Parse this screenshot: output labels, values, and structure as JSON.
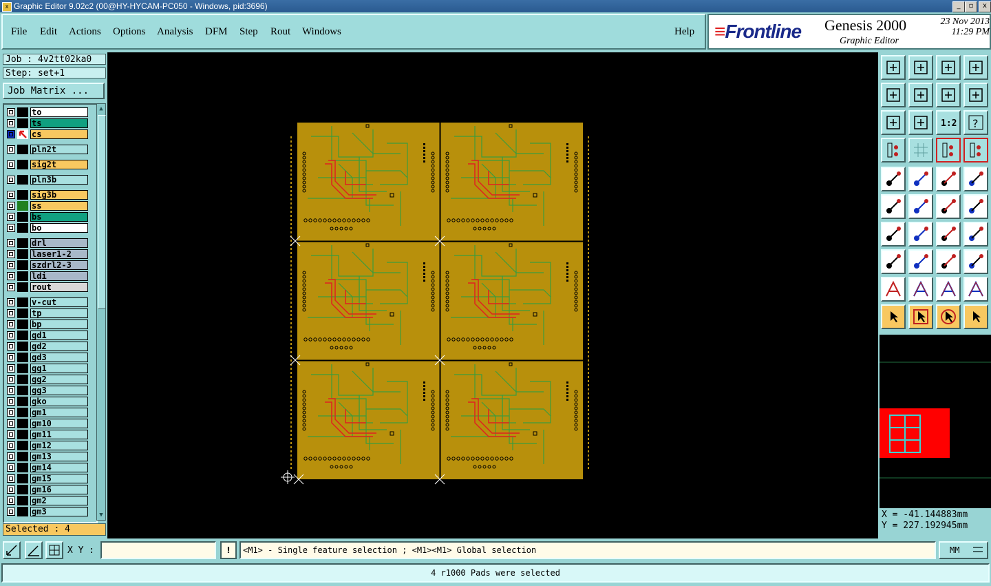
{
  "window": {
    "title": "Graphic Editor 9.02c2 (00@HY-HYCAM-PC050 - Windows, pid:3696)",
    "controls": [
      "_",
      "▫",
      "x"
    ]
  },
  "menu": {
    "items": [
      "File",
      "Edit",
      "Actions",
      "Options",
      "Analysis",
      "DFM",
      "Step",
      "Rout",
      "Windows"
    ],
    "help": "Help"
  },
  "brand": {
    "logo": "Frontline",
    "product": "Genesis 2000",
    "subtitle": "Graphic Editor",
    "date": "23 Nov 2013",
    "time": "11:29 PM"
  },
  "job": {
    "job_label": "Job : 4v2tt02ka0",
    "step_label": "Step: set+1",
    "matrix_button": "Job Matrix ..."
  },
  "layers": [
    {
      "name": "to",
      "color": "#ffffff",
      "mark": "#000000"
    },
    {
      "name": "ts",
      "color": "#10a080",
      "mark": "#000000"
    },
    {
      "name": "cs",
      "color": "#f8c860",
      "mark": "#ff3030",
      "active": true
    },
    {
      "name": "pln2t",
      "color": "#a8e0e0",
      "mark": "#000000"
    },
    {
      "name": "sig2t",
      "color": "#f8c860",
      "mark": "#000000"
    },
    {
      "name": "pln3b",
      "color": "#a8e0e0",
      "mark": "#000000"
    },
    {
      "name": "sig3b",
      "color": "#f8c860",
      "mark": "#000000"
    },
    {
      "name": "ss",
      "color": "#f8c860",
      "mark": "#208020"
    },
    {
      "name": "bs",
      "color": "#10a080",
      "mark": "#000000"
    },
    {
      "name": "bo",
      "color": "#ffffff",
      "mark": "#000000"
    },
    {
      "name": "drl",
      "color": "#a8b8c8",
      "mark": "#000000"
    },
    {
      "name": "laser1-2",
      "color": "#a8b8c8",
      "mark": "#000000"
    },
    {
      "name": "szdrl2-3",
      "color": "#a8b8c8",
      "mark": "#000000"
    },
    {
      "name": "ldi",
      "color": "#a8b8c8",
      "mark": "#000000"
    },
    {
      "name": "rout",
      "color": "#d8d8d8",
      "mark": "#000000"
    },
    {
      "name": "v-cut",
      "color": "#a8e0e0",
      "mark": "#000000"
    },
    {
      "name": "tp",
      "color": "#a8e0e0",
      "mark": "#000000"
    },
    {
      "name": "bp",
      "color": "#a8e0e0",
      "mark": "#000000"
    },
    {
      "name": "gd1",
      "color": "#a8e0e0",
      "mark": "#000000"
    },
    {
      "name": "gd2",
      "color": "#a8e0e0",
      "mark": "#000000"
    },
    {
      "name": "gd3",
      "color": "#a8e0e0",
      "mark": "#000000"
    },
    {
      "name": "gg1",
      "color": "#a8e0e0",
      "mark": "#000000"
    },
    {
      "name": "gg2",
      "color": "#a8e0e0",
      "mark": "#000000"
    },
    {
      "name": "gg3",
      "color": "#a8e0e0",
      "mark": "#000000"
    },
    {
      "name": "gko",
      "color": "#a8e0e0",
      "mark": "#000000"
    },
    {
      "name": "gm1",
      "color": "#a8e0e0",
      "mark": "#000000"
    },
    {
      "name": "gm10",
      "color": "#a8e0e0",
      "mark": "#000000"
    },
    {
      "name": "gm11",
      "color": "#a8e0e0",
      "mark": "#000000"
    },
    {
      "name": "gm12",
      "color": "#a8e0e0",
      "mark": "#000000"
    },
    {
      "name": "gm13",
      "color": "#a8e0e0",
      "mark": "#000000"
    },
    {
      "name": "gm14",
      "color": "#a8e0e0",
      "mark": "#000000"
    },
    {
      "name": "gm15",
      "color": "#a8e0e0",
      "mark": "#000000"
    },
    {
      "name": "gm16",
      "color": "#a8e0e0",
      "mark": "#000000"
    },
    {
      "name": "gm2",
      "color": "#a8e0e0",
      "mark": "#000000"
    },
    {
      "name": "gm3",
      "color": "#a8e0e0",
      "mark": "#000000"
    }
  ],
  "selection": {
    "selected_label": "Selected : 4"
  },
  "canvas": {
    "board_color": "#b8900c",
    "trace_green": "#3c9c3c",
    "trace_red": "#e02020",
    "background": "#000000"
  },
  "overview": {
    "ratio_label": "1:2"
  },
  "coords": {
    "x": "X = -41.144883mm",
    "y": "Y = 227.192945mm"
  },
  "command": {
    "xy_label": "X Y :",
    "xy_value": "",
    "bang": "!",
    "hint": "<M1> - Single feature selection ; <M1><M1> Global selection",
    "units": "MM"
  },
  "status": {
    "message": "4 r1000 Pads were selected"
  }
}
